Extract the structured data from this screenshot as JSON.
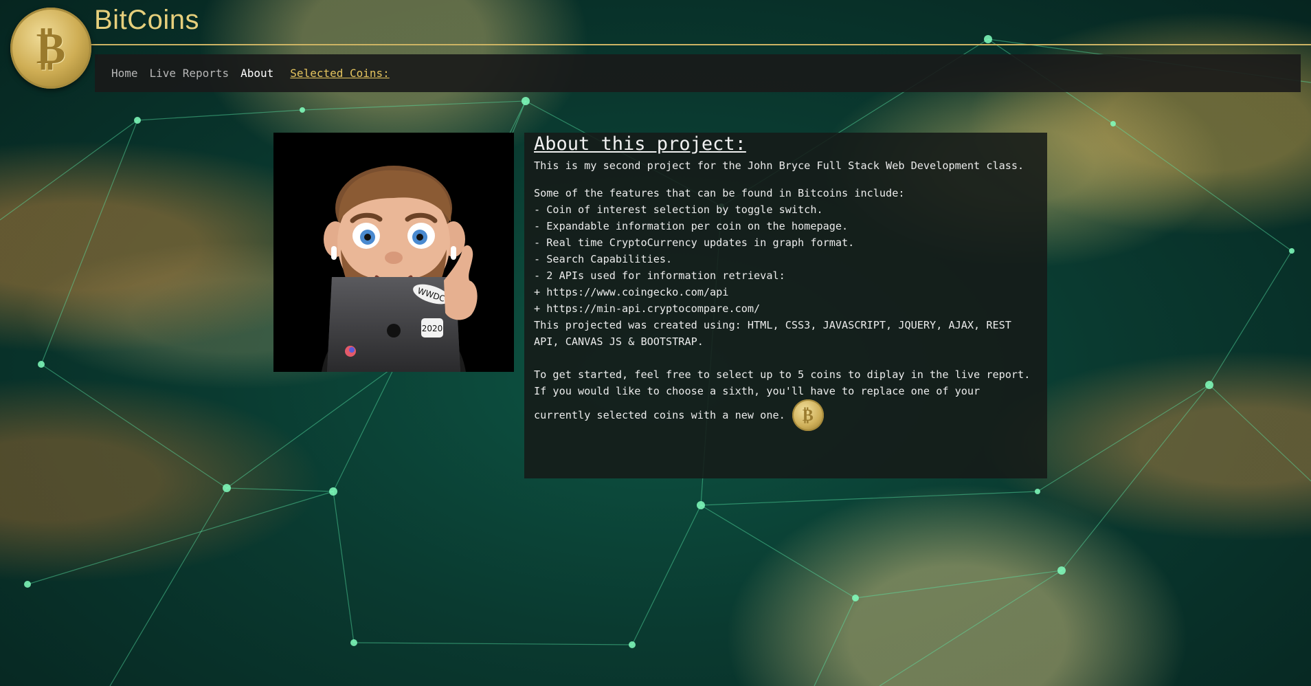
{
  "app": {
    "brand": "BitCoins",
    "logo_icon": "bitcoin-coin-icon",
    "accent_color": "#e6cf7c"
  },
  "nav": {
    "items": [
      {
        "label": "Home",
        "active": false
      },
      {
        "label": "Live Reports",
        "active": false
      },
      {
        "label": "About",
        "active": true
      }
    ],
    "selected_label": "Selected Coins:"
  },
  "about": {
    "title": "About this project:",
    "intro": "This is my second project for the John Bryce Full Stack Web Development class.",
    "features_heading": "Some of the features that can be found in Bitcoins include:",
    "features": [
      "- Coin of interest selection by toggle switch.",
      "- Expandable information per coin on the homepage.",
      "- Real time CryptoCurrency updates in graph format.",
      "- Search Capabilities.",
      "- 2 APIs used for information retrieval:",
      "+ https://www.coingecko.com/api",
      "+ https://min-api.cryptocompare.com/"
    ],
    "tech": "This projected was created using: HTML, CSS3, JAVASCRIPT, JQUERY, AJAX, REST API, CANVAS JS & BOOTSTRAP.",
    "start_text": "To get started, feel free to select up to 5 coins to diplay in the live report.",
    "sixth_text_1": "If you would like to choose a sixth, you'll have to replace one of your",
    "sixth_text_2": "currently selected coins with a new one.",
    "coin_icon": "bitcoin-coin-icon",
    "avatar_icon": "memoji-avatar-icon"
  }
}
